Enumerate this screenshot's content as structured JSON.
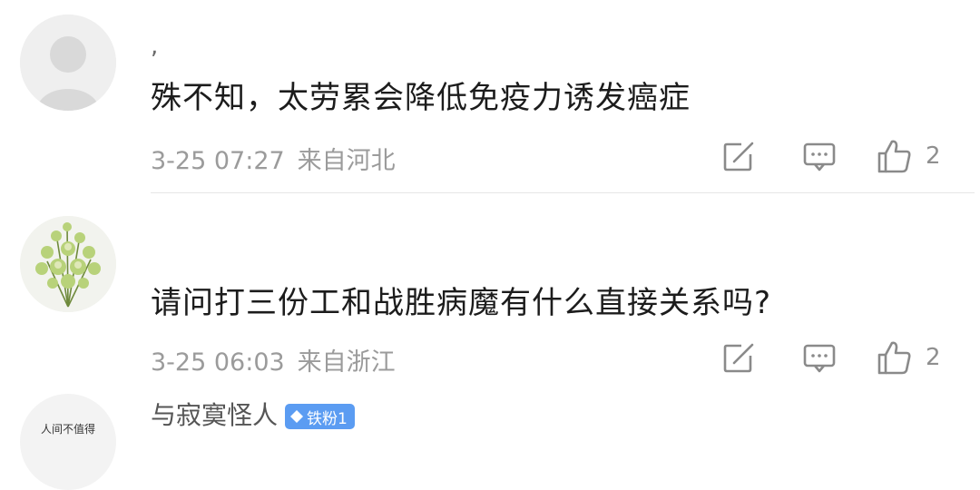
{
  "comments": [
    {
      "username": ",",
      "text": "殊不知，太劳累会降低免疫力诱发癌症",
      "date": "3-25 07:27",
      "location": "来自河北",
      "likes": "2",
      "avatar_icon": "default-user-icon"
    },
    {
      "username": "",
      "text": "请问打三份工和战胜病魔有什么直接关系吗?",
      "date": "3-25 06:03",
      "location": "来自浙江",
      "likes": "2",
      "avatar_icon": "flower-photo"
    },
    {
      "username": "与寂寞怪人",
      "badge": "铁粉1",
      "avatar_text": "人间不值得",
      "badge_color": "#5b9cf2"
    }
  ],
  "icons": {
    "edit": "edit-icon",
    "reply": "comment-icon",
    "like": "thumbs-up-icon"
  }
}
